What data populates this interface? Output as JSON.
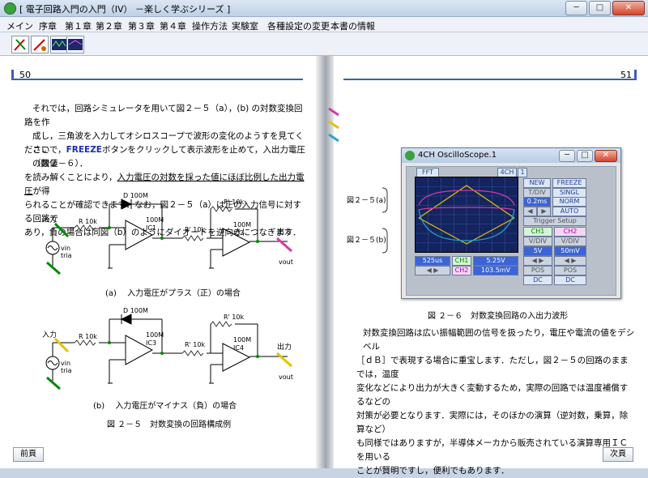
{
  "window": {
    "title": "[ 電子回路入門の入門（IV） －楽しく学ぶシリーズ ]",
    "min": "─",
    "max": "□",
    "close": "✕"
  },
  "menu": [
    "メイン",
    "序章",
    "第１章",
    "第２章",
    "第３章",
    "第４章",
    "操作方法",
    "実験室",
    "各種設定の変更",
    "本書の情報"
  ],
  "left_page": {
    "number": "50",
    "p1": [
      "それでは，回路シミュレータを用いて図２－５（a），(b) の対数変換回路を作",
      "成し，三角波を入力してオシロスコープで波形の変化のようすを見てください",
      "（図２－６）．"
    ],
    "p2a": "ここで，",
    "p2b": "FREEZE",
    "p2c": "ボタンをクリックして表示波形を止めて，入出力電圧の数値",
    "p2d": "を読み解くことにより，",
    "p2e": "入力電圧の対数を採った値にほぼ比例した出力電圧",
    "p2f": "が得",
    "p3": [
      "られることが確認できます．なお，図２－５（a）は正の入力信号に対する回路で",
      "あり，負の場合は同図（b）のようにダイオードを逆向きにつなぎます．"
    ],
    "circuit_a": {
      "diode": "D 100M",
      "res_in": "R 10k",
      "ic1": "IC1",
      "ic1_val": "100M",
      "res_mid": "R' 10k",
      "res_fb": "R' 10k",
      "ic2": "IC2",
      "ic2_val": "100M",
      "in": "入力",
      "out": "出力",
      "vin": "vin",
      "tria": "tria",
      "vout": "vout"
    },
    "caption_a": "(a)　 入力電圧がプラス（正）の場合",
    "circuit_b": {
      "diode": "D 100M",
      "res_in": "R 10k",
      "ic1": "IC3",
      "ic1_val": "100M",
      "res_mid": "R' 10k",
      "res_fb": "R' 10k",
      "ic2": "IC4",
      "ic2_val": "100M",
      "in": "入力",
      "out": "出力",
      "vin": "vin",
      "tria": "tria",
      "vout": "vout"
    },
    "caption_b": "(b)　 入力電圧がマイナス（負）の場合",
    "figure_caption": "図 ２－５　対数変換の回路構成例",
    "prev": "前頁"
  },
  "right_page": {
    "number": "51",
    "label_a": "図２－５(a)",
    "label_b": "図２－５(b)",
    "figure_caption": "図 ２－６　対数変換回路の入出力波形",
    "p1": [
      "対数変換回路は広い振幅範囲の信号を扱ったり，電圧や電流の値をデシベル",
      "［ｄＢ］で表現する場合に重宝します．ただし，図２－５の回路のままでは，温度",
      "変化などにより出力が大きく変動するため，実際の回路では温度補償するなどの",
      "対策が必要となります．実際には，そのほかの演算（逆対数，乗算，除算など）",
      "も同様ではありますが，半導体メーカから販売されている演算専用ＩＣを用いる",
      "ことが賢明ですし，便利でもあります．"
    ],
    "next": "次頁"
  },
  "oscilloscope": {
    "title": "4CH OscilloScope.1",
    "fft": "FFT",
    "ch4": "4CH",
    "ch4b": "1",
    "new": "NEW",
    "freeze": "FREEZE",
    "tdiv": "T/DIV",
    "tdiv_val": "0.2ms",
    "singl": "SINGL",
    "norm": "NORM",
    "auto": "AUTO",
    "trigger": "Trigger Setup",
    "ch1": "CH1",
    "ch2": "CH2",
    "vdiv": "V/DIV",
    "ch1_vdiv": "5V",
    "ch2_vdiv": "50mV",
    "pos": "POS",
    "dc": "DC",
    "time": "525us",
    "ch1_val": "5.25V",
    "ch2_val": "103.5mV"
  }
}
